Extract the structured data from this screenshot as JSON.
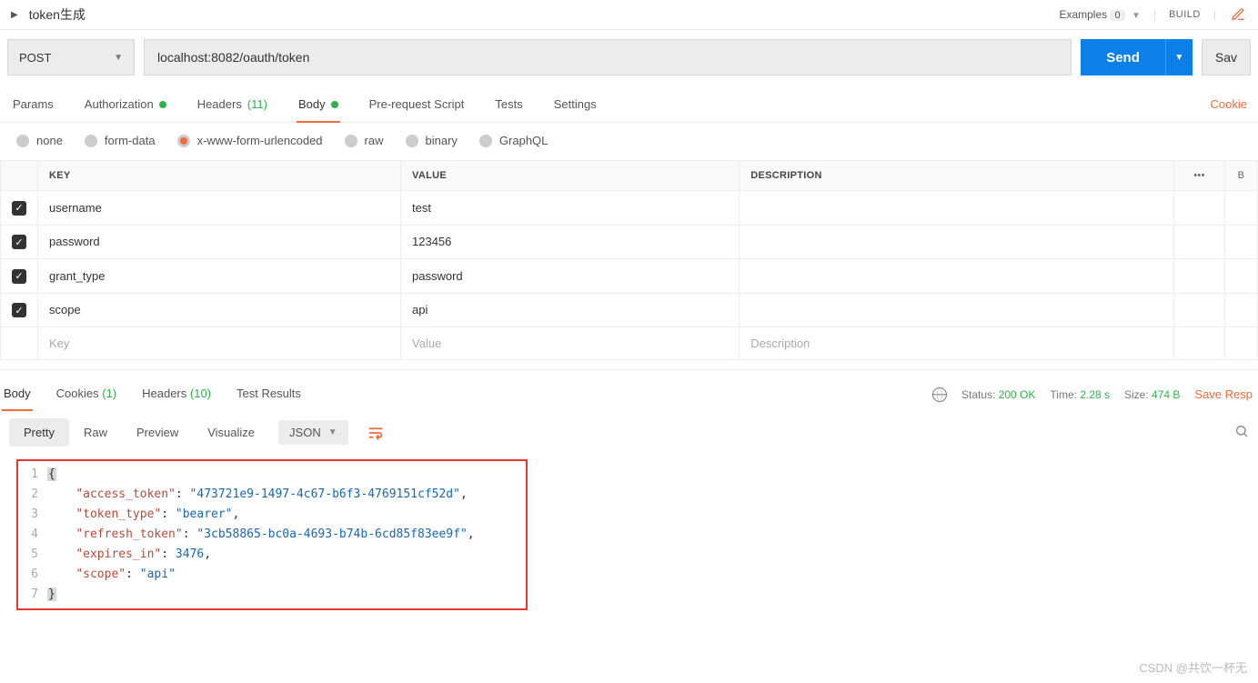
{
  "title": "token生成",
  "examples": {
    "label": "Examples",
    "count": "0"
  },
  "build": "BUILD",
  "request": {
    "method": "POST",
    "url": "localhost:8082/oauth/token",
    "send": "Send",
    "save": "Sav"
  },
  "request_tabs": {
    "params": "Params",
    "authorization": "Authorization",
    "headers": "Headers",
    "headers_count": "(11)",
    "body": "Body",
    "prerequest": "Pre-request Script",
    "tests": "Tests",
    "settings": "Settings",
    "cookies": "Cookie"
  },
  "body_types": {
    "none": "none",
    "formdata": "form-data",
    "xwww": "x-www-form-urlencoded",
    "raw": "raw",
    "binary": "binary",
    "graphql": "GraphQL"
  },
  "table": {
    "headers": {
      "key": "KEY",
      "value": "VALUE",
      "description": "DESCRIPTION",
      "bulk": "B"
    },
    "rows": [
      {
        "key": "username",
        "value": "test"
      },
      {
        "key": "password",
        "value": "123456"
      },
      {
        "key": "grant_type",
        "value": "password"
      },
      {
        "key": "scope",
        "value": "api"
      }
    ],
    "placeholders": {
      "key": "Key",
      "value": "Value",
      "description": "Description"
    }
  },
  "response_tabs": {
    "body": "Body",
    "cookies": "Cookies",
    "cookies_count": "(1)",
    "headers": "Headers",
    "headers_count": "(10)",
    "tests": "Test Results"
  },
  "response_meta": {
    "status_label": "Status:",
    "status_value": "200 OK",
    "time_label": "Time:",
    "time_value": "2.28 s",
    "size_label": "Size:",
    "size_value": "474 B",
    "save": "Save Resp"
  },
  "response_views": {
    "pretty": "Pretty",
    "raw": "Raw",
    "preview": "Preview",
    "visualize": "Visualize",
    "lang": "JSON"
  },
  "response_body": {
    "access_token_key": "\"access_token\"",
    "access_token_val": "\"473721e9-1497-4c67-b6f3-4769151cf52d\"",
    "token_type_key": "\"token_type\"",
    "token_type_val": "\"bearer\"",
    "refresh_token_key": "\"refresh_token\"",
    "refresh_token_val": "\"3cb58865-bc0a-4693-b74b-6cd85f83ee9f\"",
    "expires_in_key": "\"expires_in\"",
    "expires_in_val": "3476",
    "scope_key": "\"scope\"",
    "scope_val": "\"api\""
  },
  "watermark": "CSDN @共饮一杯无"
}
